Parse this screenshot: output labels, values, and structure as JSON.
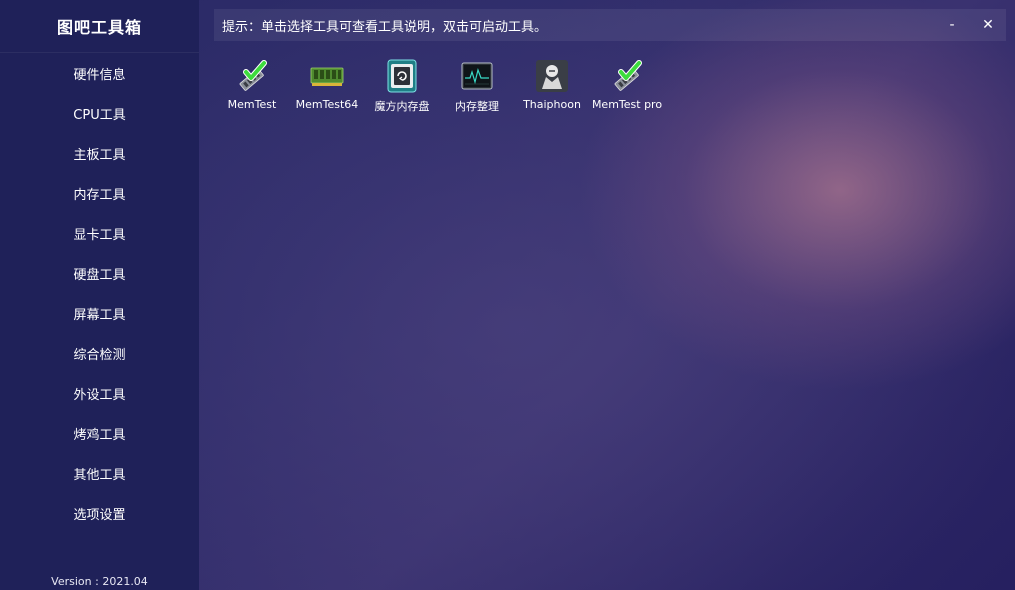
{
  "app": {
    "title": "图吧工具箱",
    "version": "Version : 2021.04"
  },
  "sidebar": {
    "items": [
      {
        "label": "硬件信息"
      },
      {
        "label": "CPU工具"
      },
      {
        "label": "主板工具"
      },
      {
        "label": "内存工具"
      },
      {
        "label": "显卡工具"
      },
      {
        "label": "硬盘工具"
      },
      {
        "label": "屏幕工具"
      },
      {
        "label": "综合检测"
      },
      {
        "label": "外设工具"
      },
      {
        "label": "烤鸡工具"
      },
      {
        "label": "其他工具"
      },
      {
        "label": "选项设置"
      }
    ]
  },
  "tip": {
    "text": "提示：单击选择工具可查看工具说明，双击可启动工具。"
  },
  "window": {
    "minimize": "-",
    "close": "✕"
  },
  "tools": [
    {
      "label": "MemTest",
      "icon": "memtest-icon"
    },
    {
      "label": "MemTest64",
      "icon": "ram-module-icon"
    },
    {
      "label": "魔方内存盘",
      "icon": "ramdisk-icon"
    },
    {
      "label": "内存整理",
      "icon": "memory-monitor-icon"
    },
    {
      "label": "Thaiphoon",
      "icon": "thaiphoon-icon"
    },
    {
      "label": "MemTest pro",
      "icon": "memtest-icon"
    }
  ],
  "colors": {
    "sidebar": "#1f2159",
    "accent_green": "#3ddc3d"
  }
}
